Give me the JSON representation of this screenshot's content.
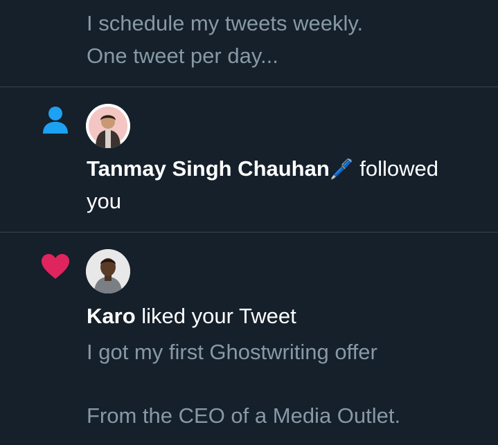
{
  "notifications": [
    {
      "type": "tweet_preview",
      "lines": [
        "I schedule my tweets weekly.",
        "One tweet per day..."
      ]
    },
    {
      "type": "follow",
      "icon": "person-icon",
      "icon_color": "#1da1f2",
      "user_name": "Tanmay Singh Chauhan",
      "emoji": "🖊️",
      "action": " followed",
      "action_line2": "you"
    },
    {
      "type": "like",
      "icon": "heart-icon",
      "icon_color": "#e0245e",
      "user_name": "Karo",
      "action": " liked your Tweet",
      "tweet_lines": [
        "I got my first Ghostwriting offer",
        "",
        "From the CEO of a Media Outlet."
      ]
    }
  ],
  "colors": {
    "background": "#15202b",
    "divider": "#38444d",
    "muted_text": "#8899a6",
    "primary_text": "#ffffff"
  }
}
